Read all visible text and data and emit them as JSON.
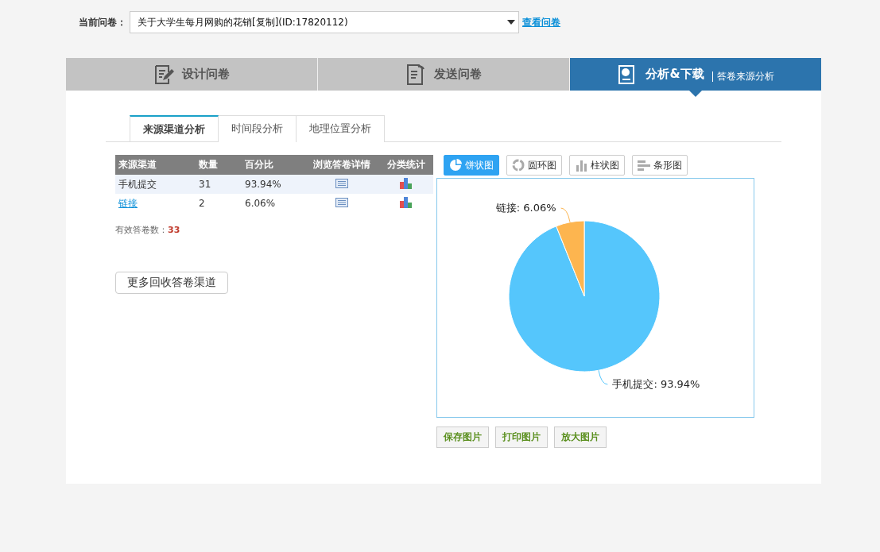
{
  "survey_select": {
    "label": "当前问卷：",
    "value": "关于大学生每月网购的花销[复制](ID:17820112)",
    "view_link": "查看问卷"
  },
  "steps": [
    {
      "label": "设计问卷",
      "selected": false
    },
    {
      "label": "发送问卷",
      "selected": false
    },
    {
      "label": "分析&下载",
      "selected": true,
      "subtitle": "答卷来源分析"
    }
  ],
  "sub_tabs": [
    {
      "label": "来源渠道分析",
      "selected": true
    },
    {
      "label": "时间段分析",
      "selected": false
    },
    {
      "label": "地理位置分析",
      "selected": false
    }
  ],
  "table": {
    "columns": [
      "来源渠道",
      "数量",
      "百分比",
      "浏览答卷详情",
      "分类统计"
    ],
    "rows": [
      {
        "source": "手机提交",
        "kind": "text",
        "count": "31",
        "percent": "93.94%"
      },
      {
        "source": "链接",
        "kind": "link",
        "count": "2",
        "percent": "6.06%"
      }
    ]
  },
  "valid_count": {
    "label": "有效答卷数：",
    "value": "33"
  },
  "more_channels_button": "更多回收答卷渠道",
  "chart_types": [
    {
      "label": "饼状图",
      "kind": "pie",
      "selected": true
    },
    {
      "label": "圆环图",
      "kind": "donut",
      "selected": false
    },
    {
      "label": "柱状图",
      "kind": "column",
      "selected": false
    },
    {
      "label": "条形图",
      "kind": "bar",
      "selected": false
    }
  ],
  "chart": {
    "chart_data": {
      "type": "pie",
      "values": [
        93.94,
        6.06
      ],
      "colors": [
        "#55c6fc",
        "#fdb54f"
      ],
      "value_labels": [
        "手机提交: 93.94%",
        "链接: 6.06%"
      ]
    }
  },
  "image_buttons": [
    "保存图片",
    "打印图片",
    "放大图片"
  ]
}
